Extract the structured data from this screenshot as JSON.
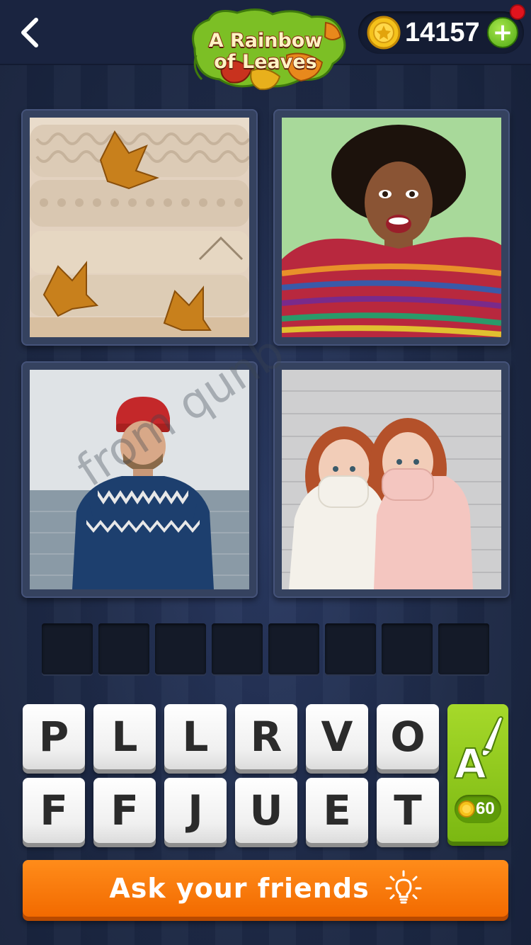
{
  "header": {
    "logo_line1": "A Rainbow",
    "logo_line2": "of Leaves",
    "coins": "14157",
    "plus_label": "+",
    "notification": true
  },
  "pictures": [
    {
      "subject": "stacked knit sweaters with autumn leaves"
    },
    {
      "subject": "woman in colorful knit sweater taking selfie"
    },
    {
      "subject": "man in red beanie and nordic sweater by the sea"
    },
    {
      "subject": "two girls pulling up white and pink knit sweaters"
    }
  ],
  "watermark": "from qunb",
  "answer": {
    "slot_count": 8,
    "letters": [
      "",
      "",
      "",
      "",
      "",
      "",
      "",
      ""
    ]
  },
  "tiles": [
    "P",
    "L",
    "L",
    "R",
    "V",
    "O",
    "F",
    "F",
    "J",
    "U",
    "E",
    "T"
  ],
  "hint": {
    "cost": "60",
    "icon": "letter-brush-icon"
  },
  "ask_button": {
    "label": "Ask your friends",
    "icon": "lightbulb-icon"
  },
  "colors": {
    "background": "#1c2744",
    "accent_orange": "#f26a00",
    "hint_green": "#7bb812",
    "coin_gold": "#f5c21b"
  }
}
